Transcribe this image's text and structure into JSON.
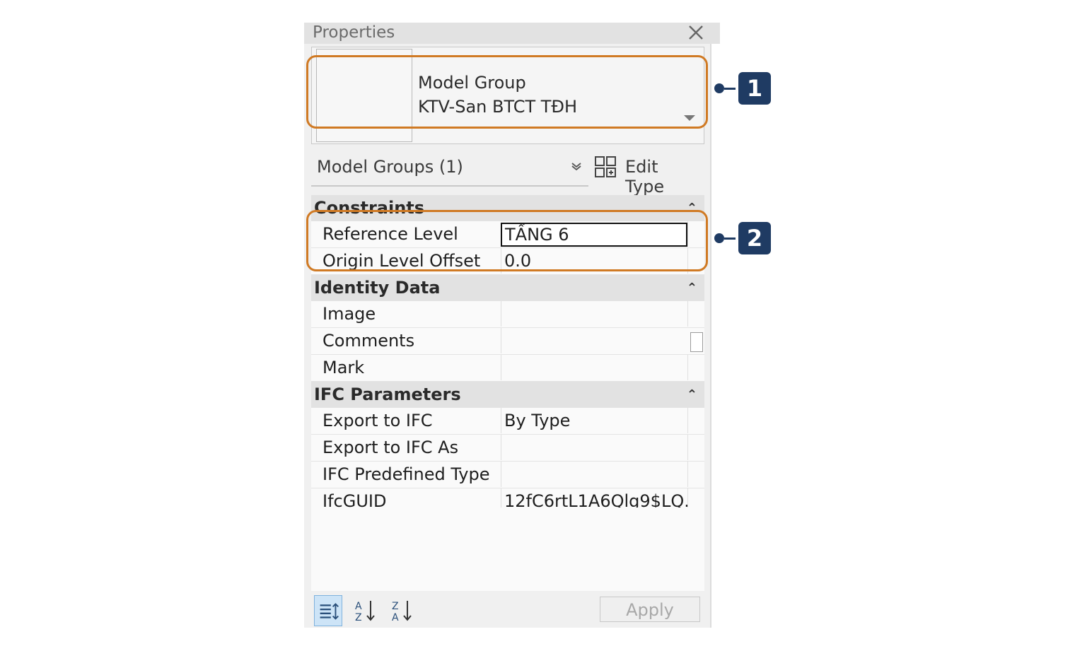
{
  "panel": {
    "title": "Properties"
  },
  "type_selector": {
    "family": "Model Group",
    "type": "KTV-San BTCT TĐH"
  },
  "filter": {
    "label": "Model Groups (1)"
  },
  "edit_type": {
    "label": "Edit Type"
  },
  "groups": [
    {
      "name": "Constraints",
      "rows": [
        {
          "label": "Reference Level",
          "value": "TẦNG 6"
        },
        {
          "label": "Origin Level Offset",
          "value": "0.0"
        }
      ]
    },
    {
      "name": "Identity Data",
      "rows": [
        {
          "label": "Image",
          "value": ""
        },
        {
          "label": "Comments",
          "value": ""
        },
        {
          "label": "Mark",
          "value": ""
        }
      ]
    },
    {
      "name": "IFC Parameters",
      "rows": [
        {
          "label": "Export to IFC",
          "value": "By Type"
        },
        {
          "label": "Export to IFC As",
          "value": ""
        },
        {
          "label": "IFC Predefined Type",
          "value": ""
        },
        {
          "label": "IfcGUID",
          "value": "12fC6rtL1A6Qlg9$LQ..."
        }
      ]
    }
  ],
  "bottom": {
    "apply_label": "Apply"
  },
  "callouts": {
    "one": "1",
    "two": "2"
  },
  "colors": {
    "highlight": "#d07a24",
    "badge": "#1f3b63"
  },
  "icons": {
    "close": "close-icon",
    "edit_type": "edit-type-icon",
    "collapse": "collapse-up-icon",
    "categorized": "categorized-view-icon",
    "sort_asc": "sort-ascending-icon",
    "sort_desc": "sort-descending-icon"
  }
}
